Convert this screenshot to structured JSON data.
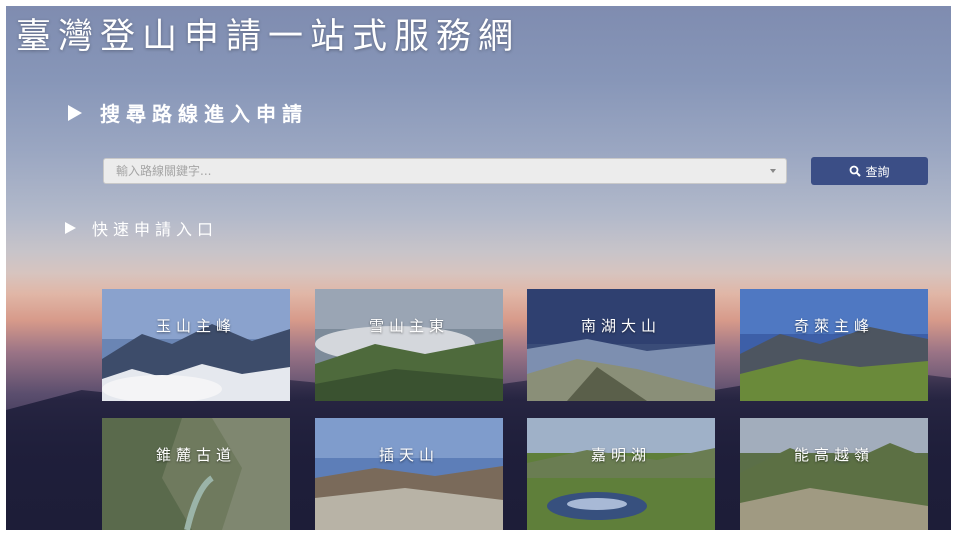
{
  "title": "臺灣登山申請一站式服務網",
  "search_section": {
    "heading": "搜尋路線進入申請",
    "placeholder": "輸入路線關鍵字...",
    "button_label": "查詢"
  },
  "quick_section": {
    "heading": "快速申請入口",
    "routes": [
      {
        "label": "玉山主峰"
      },
      {
        "label": "雪山主東"
      },
      {
        "label": "南湖大山"
      },
      {
        "label": "奇萊主峰"
      },
      {
        "label": "錐麓古道"
      },
      {
        "label": "插天山"
      },
      {
        "label": "嘉明湖"
      },
      {
        "label": "能高越嶺"
      }
    ]
  },
  "colors": {
    "button": "#3b4e86",
    "text": "#ffffff"
  }
}
